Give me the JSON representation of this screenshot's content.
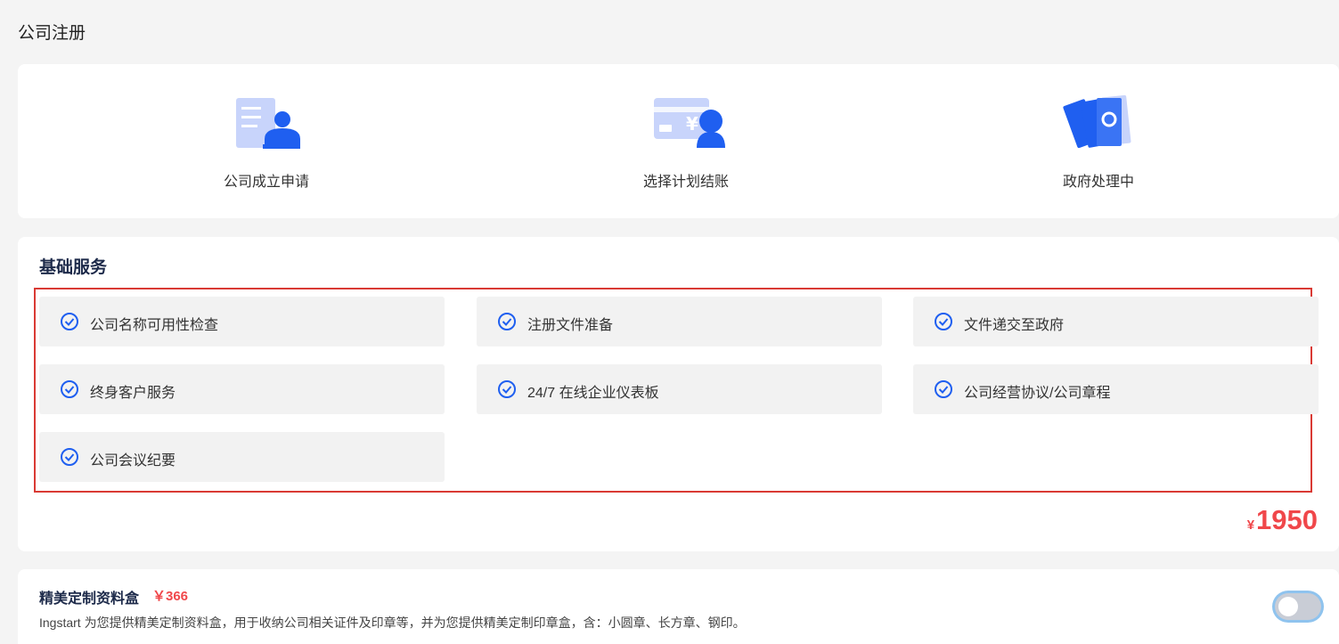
{
  "page": {
    "title": "公司注册"
  },
  "steps": [
    {
      "label": "公司成立申请",
      "icon": "application-form-icon"
    },
    {
      "label": "选择计划结账",
      "icon": "payment-card-icon"
    },
    {
      "label": "政府处理中",
      "icon": "government-documents-icon"
    }
  ],
  "basic_services": {
    "title": "基础服务",
    "items": [
      {
        "label": "公司名称可用性检查"
      },
      {
        "label": "注册文件准备"
      },
      {
        "label": "文件递交至政府"
      },
      {
        "label": "终身客户服务"
      },
      {
        "label": "24/7 在线企业仪表板"
      },
      {
        "label": "公司经营协议/公司章程"
      },
      {
        "label": "公司会议纪要"
      }
    ],
    "price_currency": "¥",
    "price_amount": "1950"
  },
  "addon": {
    "title": "精美定制资料盒",
    "price": "￥366",
    "description": "Ingstart 为您提供精美定制资料盒，用于收纳公司相关证件及印章等，并为您提供精美定制印章盒，含：小圆章、长方章、钢印。",
    "toggle_on": false
  },
  "colors": {
    "accent_blue": "#1f5ff0",
    "light_blue": "#c8d4fb",
    "price_red": "#f0474a",
    "highlight_red": "#d93a34"
  }
}
